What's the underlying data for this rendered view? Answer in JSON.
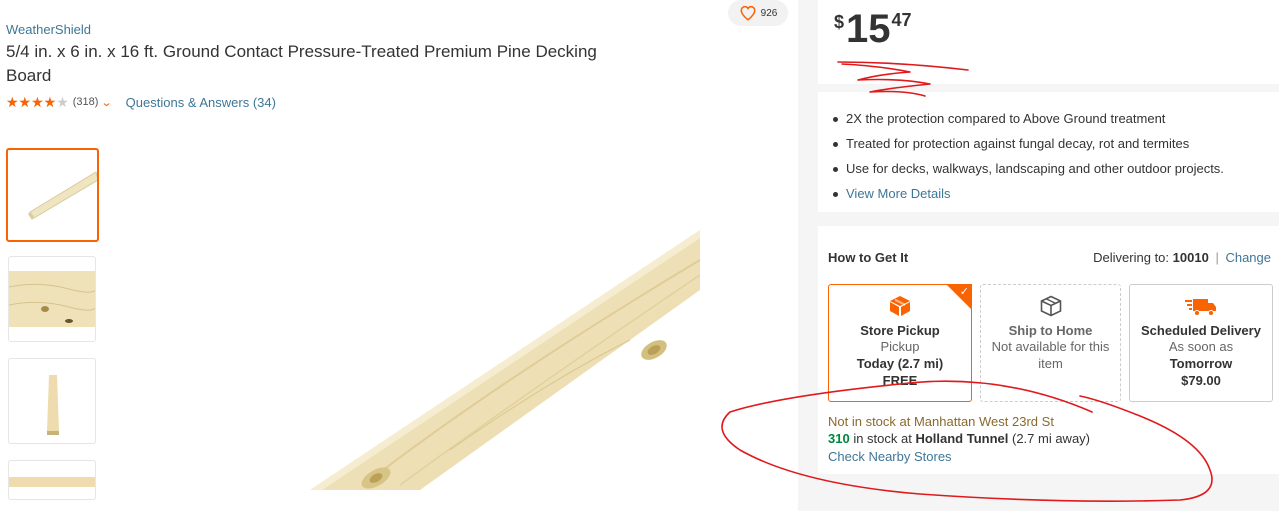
{
  "product": {
    "brand": "WeatherShield",
    "title": "5/4 in. x 6 in. x 16 ft. Ground Contact Pressure-Treated Premium Pine Decking Board",
    "rating": 4.0,
    "review_count": "(318)",
    "qa_link": "Questions & Answers (34)",
    "favorites": "926",
    "stars": "★★★★★"
  },
  "price": {
    "currency": "$",
    "dollars": "15",
    "cents": "47"
  },
  "highlights": [
    "2X the protection compared to Above Ground treatment",
    "Treated for protection against fungal decay, rot and termites",
    "Use for decks, walkways, landscaping and other outdoor projects.",
    "View More Details"
  ],
  "fulfillment": {
    "heading": "How to Get It",
    "delivering_label": "Delivering to:",
    "zip": "10010",
    "separator": "|",
    "change": "Change",
    "options": [
      {
        "name": "Store Pickup",
        "line1": "Pickup",
        "line2": "Today (2.7 mi)",
        "line3": "FREE",
        "icon": "pickup-box-icon"
      },
      {
        "name": "Ship to Home",
        "line1": "Not available for this item",
        "icon": "shipping-box-icon"
      },
      {
        "name": "Scheduled Delivery",
        "line1": "As soon as",
        "line2": "Tomorrow",
        "line3": "$79.00",
        "icon": "delivery-truck-icon"
      }
    ],
    "check": "✓"
  },
  "stock": {
    "not_in_stock": "Not in stock at Manhattan West 23rd St",
    "count": "310",
    "in_stock_at": " in stock at ",
    "store": "Holland Tunnel",
    "distance": " (2.7 mi away)",
    "check_nearby": "Check Nearby Stores"
  },
  "colors": {
    "accent": "#f96302",
    "link": "#3e7697",
    "in_stock": "#00873c",
    "annotation": "#e0191c"
  }
}
